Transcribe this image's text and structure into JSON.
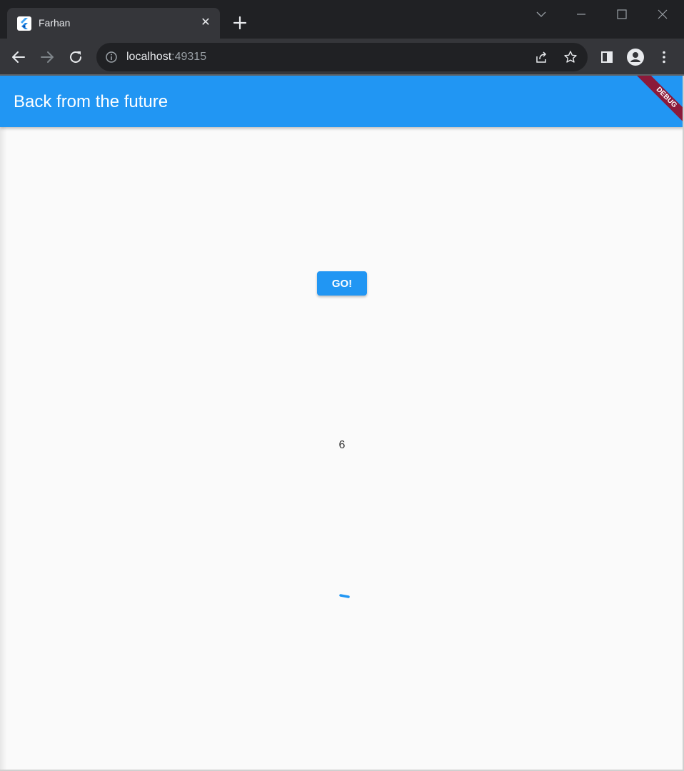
{
  "browser": {
    "tab": {
      "title": "Farhan",
      "favicon": "flutter-logo-icon",
      "close_symbol": "✕"
    },
    "window_controls": [
      "chevron-down-icon",
      "minimize-icon",
      "maximize-icon",
      "close-icon"
    ],
    "nav": {
      "back": "back-arrow-icon",
      "forward": "forward-arrow-icon",
      "reload": "reload-icon"
    },
    "address": {
      "host": "localhost",
      "port": ":49315"
    }
  },
  "app": {
    "title": "Back from the future",
    "debug_banner": "DEBUG",
    "go_button_label": "GO!",
    "result": "6",
    "accent_color": "#2196f3"
  }
}
